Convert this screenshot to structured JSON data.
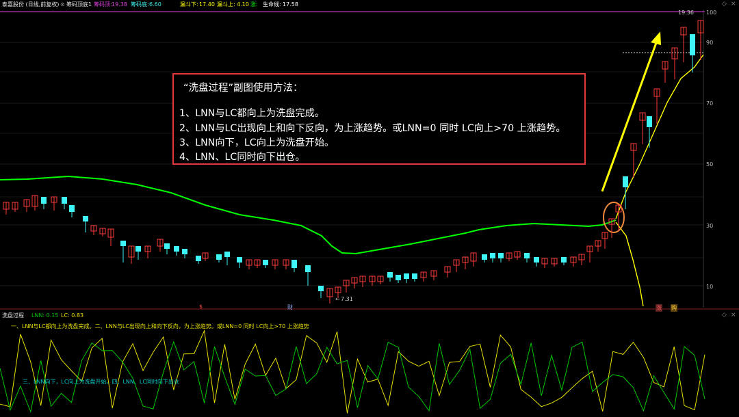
{
  "header": {
    "stock_name": "泰嘉股份 (日线,前复权)",
    "indicator_name": "筹码顶底1",
    "chip_top_label": "筹码顶:",
    "chip_top_value": "19.38",
    "chip_bottom_label": "筹码底:",
    "chip_bottom_value": "6.60",
    "funnel_low_label": "漏斗下:",
    "funnel_low_value": "17.40",
    "funnel_high_label": "漏斗上:",
    "funnel_high_value": "4.10",
    "rise_label": "涨:",
    "lifeline_label": "生命线:",
    "lifeline_value": "17.58",
    "colors": {
      "chip_top": "#e040e0",
      "funnel": "#ffff00",
      "rise": "#00ff00",
      "lifeline": "#ffffff"
    }
  },
  "main_chart": {
    "y_ticks": [
      "100",
      "90",
      "70",
      "50",
      "30",
      "10"
    ],
    "high_marker": "19.36",
    "low_marker": "7.31",
    "bottom_markers": [
      "$",
      "财",
      "涨",
      "购"
    ],
    "colors": {
      "up": "#ff3b3b",
      "down": "#3ff4f4",
      "lifeline": "#00ff00",
      "yellow_line": "#ffff00",
      "top_line": "#e040e0",
      "circle": "#f08a3a"
    }
  },
  "note": {
    "title": "“洗盘过程”副图使用方法：",
    "lines": [
      "1、LNN与LC都向上为洗盘完成。",
      "2、LNN与LC出现向上和向下反向，为上涨趋势。或LNN=0 同时 LC向上>70 上涨趋势。",
      "3、LNN向下，LC向上为洗盘开始。",
      "4、LNN、LC同时向下出仓。"
    ]
  },
  "sub_chart": {
    "name": "洗盘过程",
    "lnn_label": "LNN: 0.15",
    "lc_label": "LC: 0.83",
    "text1": "一、LNN与LC都向上为洗盘完成。二、LNN与LC出现向上和向下反向，为上涨趋势。或LNN=0 同时 LC向上>70 上涨趋势",
    "text2": "三、LNN向下，LC向上为洗盘开始。四、LNN、LC同时向下出仓",
    "colors": {
      "lnn": "#00c800",
      "lc": "#e8e000",
      "text1": "#e8e000",
      "text2": "#00c8c8"
    }
  }
}
